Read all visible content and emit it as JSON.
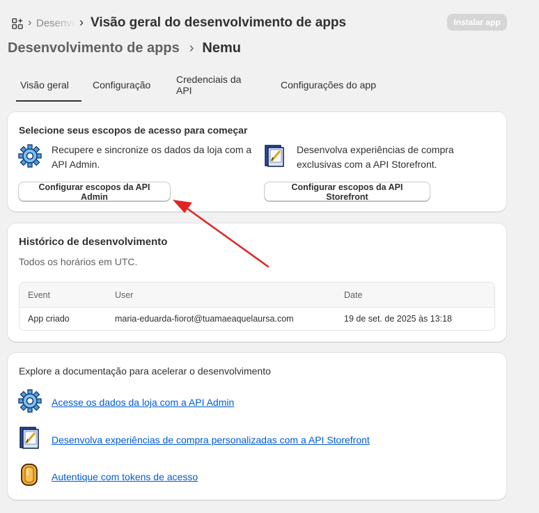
{
  "header": {
    "breadcrumb_faded": "Desenvolvimento de apps",
    "breadcrumb_sep": "›",
    "title": "Visão geral do desenvolvimento de apps",
    "install_button": "Instalar app"
  },
  "page_heading": {
    "parent": "Desenvolvimento de apps",
    "separator": "›",
    "current": "Nemu"
  },
  "tabs": [
    {
      "label": "Visão geral",
      "selected": true
    },
    {
      "label": "Configuração",
      "selected": false
    },
    {
      "label": "Credenciais da API",
      "selected": false
    },
    {
      "label": "Configurações do app",
      "selected": false
    }
  ],
  "scopes_card": {
    "title": "Selecione seus escopos de acesso para começar",
    "admin": {
      "icon": "gear-icon",
      "line1": "Recupere e sincronize os dados da loja com a",
      "line2": "API Admin.",
      "button": "Configurar escopos da API Admin"
    },
    "storefront": {
      "icon": "storefront-icon",
      "line1": "Desenvolva experiências de compra",
      "line2": "exclusivas com a API Storefront.",
      "button": "Configurar escopos da API Storefront"
    }
  },
  "history_card": {
    "title": "Histórico de desenvolvimento",
    "subtitle": "Todos os horários em UTC.",
    "columns": [
      "Event",
      "User",
      "Date"
    ],
    "rows": [
      {
        "event": "App criado",
        "user": "maria-eduarda-fiorot@tuamaeaquelaursa.com",
        "date": "19 de set. de 2025 às 13:18"
      }
    ]
  },
  "docs_card": {
    "title": "Explore a documentação para acelerar o desenvolvimento",
    "links": [
      {
        "icon": "gear-icon",
        "label": "Acesse os dados da loja com a API Admin"
      },
      {
        "icon": "storefront-icon",
        "label": "Desenvolva experiências de compra personalizadas com a API Storefront"
      },
      {
        "icon": "token-icon",
        "label": "Autentique com tokens de acesso"
      }
    ]
  },
  "colors": {
    "background": "#f1f1f1",
    "link": "#005bd3",
    "annotation_arrow": "#e02424"
  }
}
